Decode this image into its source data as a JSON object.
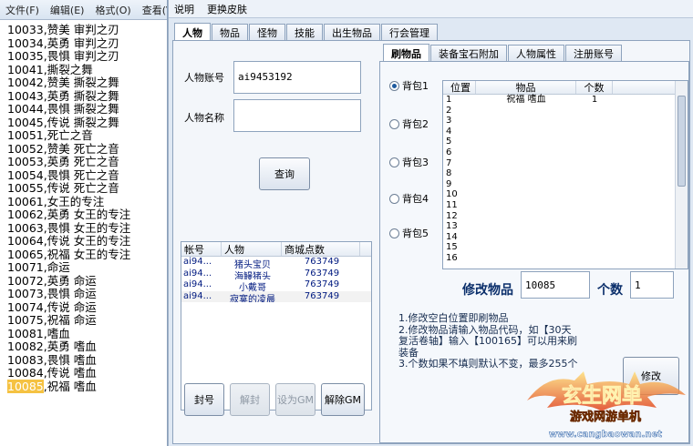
{
  "notepad": {
    "menu": [
      "文件(F)",
      "编辑(E)",
      "格式(O)",
      "查看(V"
    ],
    "lines": [
      "10033,赞美 审判之刃",
      "10034,英勇 审判之刃",
      "10035,畏惧 审判之刃",
      "10041,撕裂之舞",
      "10042,赞美 撕裂之舞",
      "10043,英勇 撕裂之舞",
      "10044,畏惧 撕裂之舞",
      "10045,传说 撕裂之舞",
      "10051,死亡之音",
      "10052,赞美 死亡之音",
      "10053,英勇 死亡之音",
      "10054,畏惧 死亡之音",
      "10055,传说 死亡之音",
      "10061,女王的专注",
      "10062,英勇 女王的专注",
      "10063,畏惧 女王的专注",
      "10064,传说 女王的专注",
      "10065,祝福 女王的专注",
      "10071,命运",
      "10072,英勇 命运",
      "10073,畏惧 命运",
      "10074,传说 命运",
      "10075,祝福 命运",
      "10081,嗜血",
      "10082,英勇 嗜血",
      "10083,畏惧 嗜血",
      "10084,传说 嗜血"
    ],
    "last_line_selected": "10085",
    "last_line_rest": ",祝福 嗜血"
  },
  "main": {
    "menu": [
      "说明",
      "更换皮肤"
    ],
    "tabs": [
      "人物",
      "物品",
      "怪物",
      "技能",
      "出生物品",
      "行会管理"
    ],
    "account_label": "人物账号",
    "account_value": "ai9453192",
    "name_label": "人物名称",
    "name_value": "",
    "query_button": "查询",
    "char_table": {
      "headers": [
        "帐号",
        "人物",
        "商城点数"
      ],
      "rows": [
        [
          "ai94...",
          "猪头宝贝",
          "763749"
        ],
        [
          "ai94...",
          "海鳗猪头",
          "763749"
        ],
        [
          "ai94...",
          "小戴哥",
          "763749"
        ],
        [
          "ai94...",
          "寂寞的凌晨",
          "763749"
        ]
      ]
    },
    "buttons": {
      "ban": "封号",
      "unban": "解封",
      "set_gm": "设为GM",
      "unset_gm": "解除GM"
    },
    "sub_tabs": [
      "刷物品",
      "装备宝石附加",
      "人物属性",
      "注册账号"
    ],
    "bags": [
      "背包1",
      "背包2",
      "背包3",
      "背包4",
      "背包5"
    ],
    "selected_bag": 0,
    "item_table": {
      "headers": [
        "位置",
        "物品",
        "个数"
      ],
      "rows": [
        [
          "1",
          "祝福 嗜血",
          "1"
        ],
        [
          "2",
          "",
          ""
        ],
        [
          "3",
          "",
          ""
        ],
        [
          "4",
          "",
          ""
        ],
        [
          "5",
          "",
          ""
        ],
        [
          "6",
          "",
          ""
        ],
        [
          "7",
          "",
          ""
        ],
        [
          "8",
          "",
          ""
        ],
        [
          "9",
          "",
          ""
        ],
        [
          "10",
          "",
          ""
        ],
        [
          "11",
          "",
          ""
        ],
        [
          "12",
          "",
          ""
        ],
        [
          "13",
          "",
          ""
        ],
        [
          "14",
          "",
          ""
        ],
        [
          "15",
          "",
          ""
        ],
        [
          "16",
          "",
          ""
        ]
      ]
    },
    "modify_label": "修改物品",
    "modify_value": "10085",
    "count_label": "个数",
    "count_value": "1",
    "notes": [
      "1.修改空白位置即刷物品",
      "2.修改物品请输入物品代码，如【30天",
      "复活卷轴】输入【100165】可以用来刷",
      "装备",
      "3.个数如果不填则默认不变，最多255个"
    ],
    "modify_button": "修改"
  },
  "watermark": {
    "line1": "玄生网单",
    "line2": "游戏网游单机",
    "url": "www.cangbaowan.net"
  }
}
